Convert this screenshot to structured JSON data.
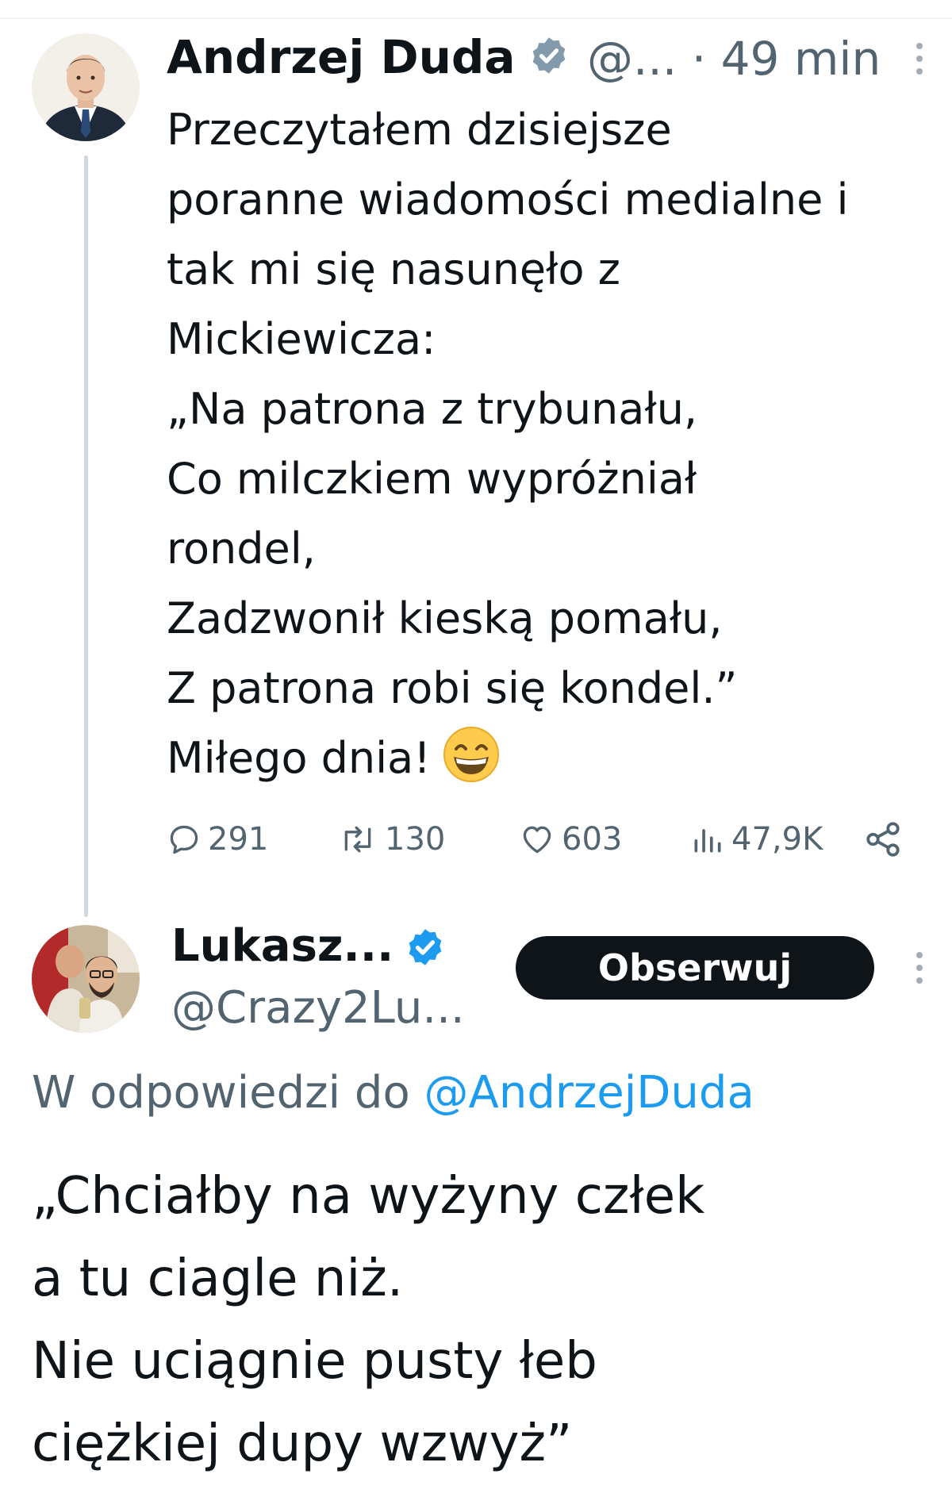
{
  "tweet": {
    "author_name": "Andrzej Duda",
    "handle": "@...",
    "separator": "·",
    "time": "49 min",
    "lines": [
      "Przeczytałem dzisiejsze",
      "poranne wiadomości medialne i",
      "tak mi się nasunęło z",
      "Mickiewicza:",
      "„Na patrona z trybunału,",
      "Co milczkiem wypróżniał",
      "rondel,",
      "Zadzwonił kieską pomału,",
      "Z patrona robi się kondel.”",
      "Miłego dnia!"
    ],
    "emoji": "grinning-face-with-smiling-eyes",
    "stats": {
      "replies": "291",
      "reposts": "130",
      "likes": "603",
      "views": "47,9K"
    }
  },
  "reply": {
    "author_name": "Lukasz...",
    "handle": "@Crazy2Lu...",
    "follow_label": "Obserwuj",
    "reply_to_prefix": "W odpowiedzi do",
    "reply_to_handle": "@AndrzejDuda",
    "lines": [
      "„Chciałby na wyżyny człek",
      "a tu ciagle niż.",
      "Nie uciągnie pusty łeb",
      "ciężkiej dupy wzwyż”"
    ]
  },
  "colors": {
    "text": "#0f1419",
    "secondary": "#536471",
    "link": "#1d9bf0",
    "verified_blue": "#1d9bf0",
    "verified_gray": "#829aab",
    "button_bg": "#0f1419"
  },
  "icons": [
    "verified-badge-icon",
    "more-icon",
    "reply-icon",
    "repost-icon",
    "like-icon",
    "views-icon",
    "share-icon"
  ]
}
